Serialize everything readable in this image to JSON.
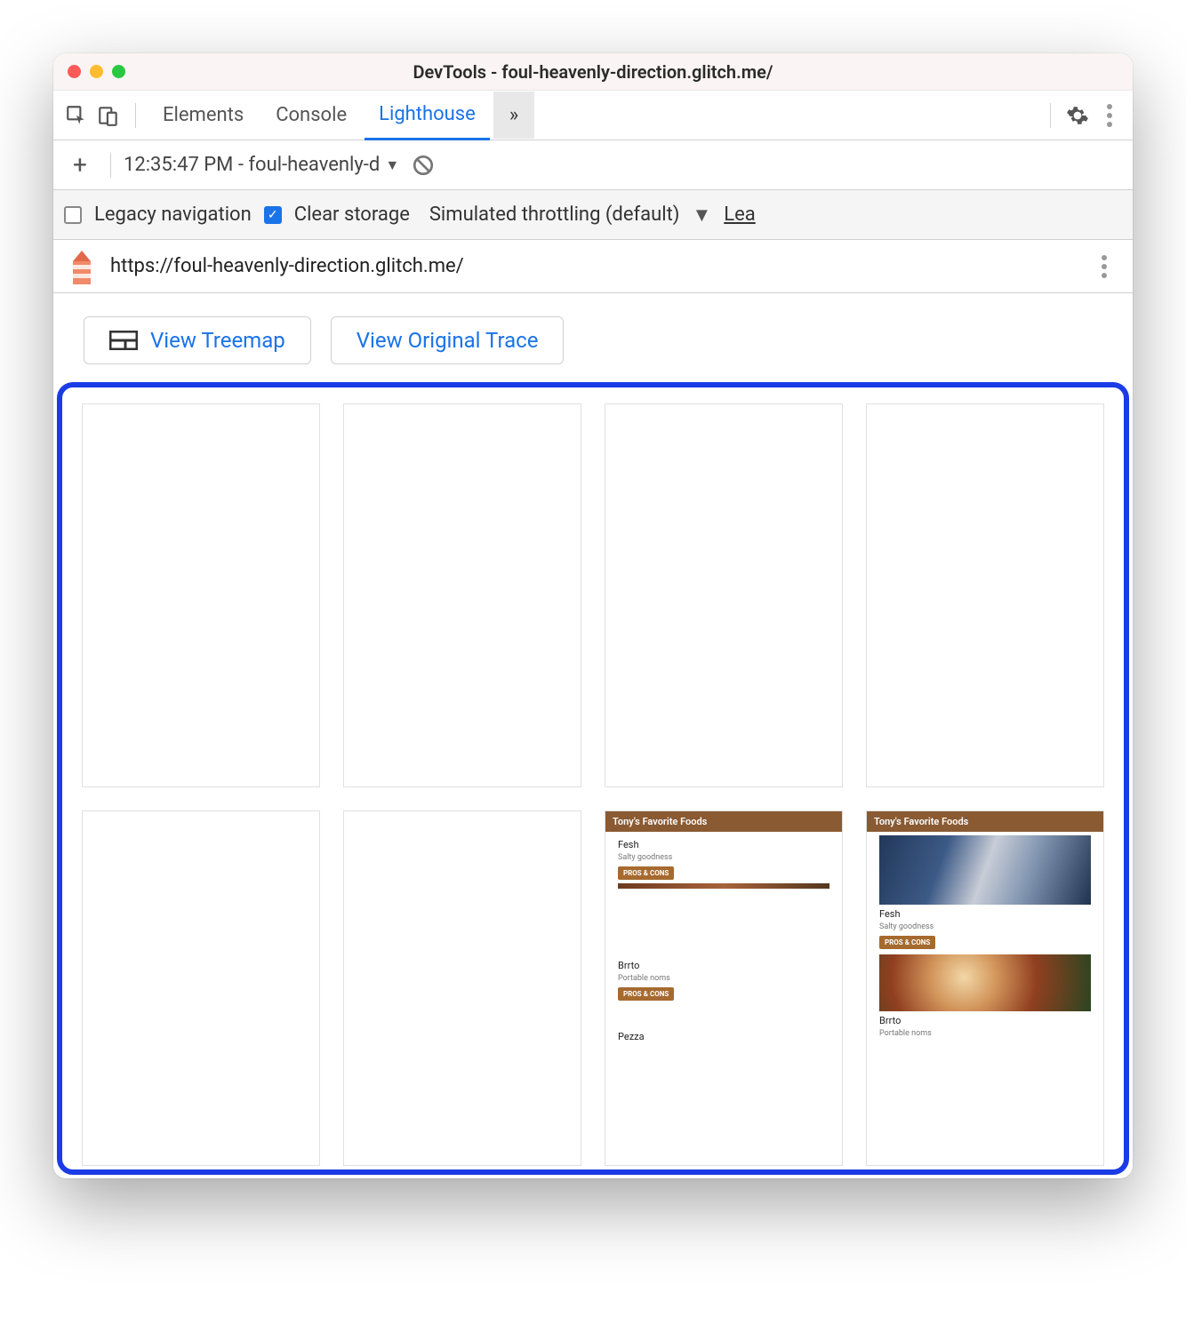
{
  "window": {
    "title": "DevTools - foul-heavenly-direction.glitch.me/"
  },
  "tabs": {
    "elements": "Elements",
    "console": "Console",
    "lighthouse": "Lighthouse",
    "more": "»"
  },
  "reportbar": {
    "selected": "12:35:47 PM - foul-heavenly-d"
  },
  "options": {
    "legacy_label": "Legacy navigation",
    "clear_label": "Clear storage",
    "throttling_label": "Simulated throttling (default)",
    "learn_label": "Lea"
  },
  "urlbar": {
    "url": "https://foul-heavenly-direction.glitch.me/"
  },
  "actions": {
    "treemap": "View Treemap",
    "trace": "View Original Trace"
  },
  "filmstrip": {
    "header": "Tony's Favorite Foods",
    "items": [
      {
        "title": "Fesh",
        "sub": "Salty goodness",
        "btn": "PROS & CONS"
      },
      {
        "title": "Brrto",
        "sub": "Portable noms",
        "btn": "PROS & CONS"
      },
      {
        "title": "Pezza",
        "sub": "",
        "btn": ""
      }
    ]
  }
}
